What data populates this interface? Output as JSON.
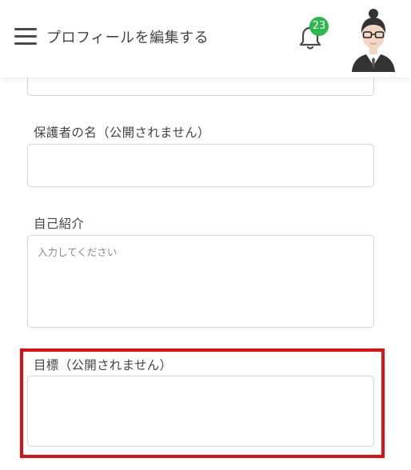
{
  "header": {
    "title": "プロフィールを編集する",
    "notification_count": "23",
    "badge_color": "#2db84d"
  },
  "icons": {
    "menu": "hamburger-menu-icon",
    "bell": "bell-icon",
    "avatar": "user-avatar-glasses"
  },
  "form": {
    "guardian_name": {
      "label": "保護者の名（公開されません）",
      "value": "",
      "placeholder": ""
    },
    "self_intro": {
      "label": "自己紹介",
      "value": "",
      "placeholder": "入力してください"
    },
    "goal": {
      "label": "目標（公開されません）",
      "value": "",
      "placeholder": ""
    }
  },
  "highlight_color": "#e01010"
}
